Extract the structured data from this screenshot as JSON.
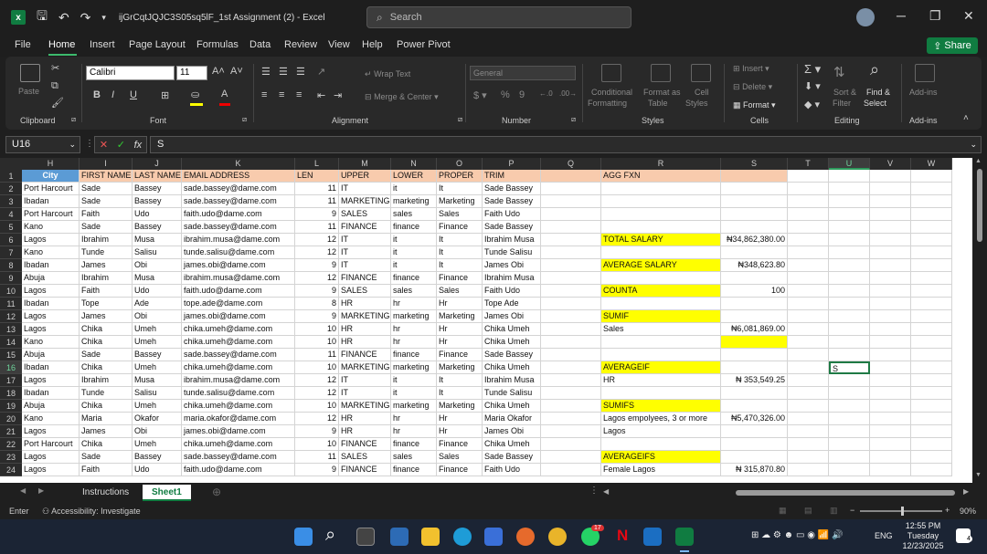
{
  "window": {
    "title": "ijGrCqtJQJC3S05sq5lF_1st Assignment (2)  -  Excel",
    "search_placeholder": "Search"
  },
  "menu": {
    "items": [
      "File",
      "Home",
      "Insert",
      "Page Layout",
      "Formulas",
      "Data",
      "Review",
      "View",
      "Help",
      "Power Pivot"
    ],
    "share_label": "Share"
  },
  "ribbon": {
    "groups": [
      "Clipboard",
      "Font",
      "Alignment",
      "Number",
      "Styles",
      "Cells",
      "Editing",
      "Add-ins"
    ],
    "paste": "Paste",
    "font_name": "Calibri",
    "font_size": "11",
    "wrap_text": "Wrap Text",
    "merge_center": "Merge & Center",
    "number_format": "General",
    "conditional_formatting": [
      "Conditional",
      "Formatting"
    ],
    "format_as_table": [
      "Format as",
      "Table"
    ],
    "cell_styles": [
      "Cell",
      "Styles"
    ],
    "insert": "Insert",
    "delete": "Delete",
    "format": "Format",
    "sort_filter": [
      "Sort &",
      "Filter"
    ],
    "find_select": [
      "Find &",
      "Select"
    ],
    "add_ins": "Add-ins"
  },
  "formula_bar": {
    "name_box": "U16",
    "formula": "S"
  },
  "grid": {
    "columns": [
      "H",
      "I",
      "J",
      "K",
      "L",
      "M",
      "N",
      "O",
      "P",
      "Q",
      "R",
      "S",
      "T",
      "U",
      "V",
      "W"
    ],
    "row_numbers": [
      "1",
      "2",
      "3",
      "4",
      "5",
      "6",
      "7",
      "8",
      "9",
      "10",
      "11",
      "12",
      "13",
      "14",
      "15",
      "16",
      "17",
      "18",
      "19",
      "20",
      "21",
      "22",
      "23",
      "24"
    ],
    "headers": [
      "City",
      "FIRST NAME",
      "LAST NAME",
      "EMAIL ADDRESS",
      "LEN",
      "UPPER",
      "LOWER",
      "PROPER",
      "TRIM",
      "AGG FXN"
    ],
    "rows": [
      [
        "Port Harcourt",
        "Sade",
        "Bassey",
        "sade.bassey@dame.com",
        "11",
        "IT",
        "it",
        "It",
        "Sade Bassey"
      ],
      [
        "Ibadan",
        "Sade",
        "Bassey",
        "sade.bassey@dame.com",
        "11",
        "MARKETING",
        "marketing",
        "Marketing",
        "Sade Bassey"
      ],
      [
        "Port Harcourt",
        "Faith",
        "Udo",
        "faith.udo@dame.com",
        "9",
        "SALES",
        "sales",
        "Sales",
        "Faith Udo"
      ],
      [
        "Kano",
        "Sade",
        "Bassey",
        "sade.bassey@dame.com",
        "11",
        "FINANCE",
        "finance",
        "Finance",
        "Sade Bassey"
      ],
      [
        "Lagos",
        "Ibrahim",
        "Musa",
        "ibrahim.musa@dame.com",
        "12",
        "IT",
        "it",
        "It",
        "Ibrahim Musa"
      ],
      [
        "Kano",
        "Tunde",
        "Salisu",
        "tunde.salisu@dame.com",
        "12",
        "IT",
        "it",
        "It",
        "Tunde Salisu"
      ],
      [
        "Ibadan",
        "James",
        "Obi",
        "james.obi@dame.com",
        "9",
        "IT",
        "it",
        "It",
        "James Obi"
      ],
      [
        "Abuja",
        "Ibrahim",
        "Musa",
        "ibrahim.musa@dame.com",
        "12",
        "FINANCE",
        "finance",
        "Finance",
        "Ibrahim Musa"
      ],
      [
        "Lagos",
        "Faith",
        "Udo",
        "faith.udo@dame.com",
        "9",
        "SALES",
        "sales",
        "Sales",
        "Faith Udo"
      ],
      [
        "Ibadan",
        "Tope",
        "Ade",
        "tope.ade@dame.com",
        "8",
        "HR",
        "hr",
        "Hr",
        "Tope Ade"
      ],
      [
        "Lagos",
        "James",
        "Obi",
        "james.obi@dame.com",
        "9",
        "MARKETING",
        "marketing",
        "Marketing",
        "James Obi"
      ],
      [
        "Lagos",
        "Chika",
        "Umeh",
        "chika.umeh@dame.com",
        "10",
        "HR",
        "hr",
        "Hr",
        "Chika Umeh"
      ],
      [
        "Kano",
        "Chika",
        "Umeh",
        "chika.umeh@dame.com",
        "10",
        "HR",
        "hr",
        "Hr",
        "Chika Umeh"
      ],
      [
        "Abuja",
        "Sade",
        "Bassey",
        "sade.bassey@dame.com",
        "11",
        "FINANCE",
        "finance",
        "Finance",
        "Sade Bassey"
      ],
      [
        "Ibadan",
        "Chika",
        "Umeh",
        "chika.umeh@dame.com",
        "10",
        "MARKETING",
        "marketing",
        "Marketing",
        "Chika Umeh"
      ],
      [
        "Lagos",
        "Ibrahim",
        "Musa",
        "ibrahim.musa@dame.com",
        "12",
        "IT",
        "it",
        "It",
        "Ibrahim Musa"
      ],
      [
        "Ibadan",
        "Tunde",
        "Salisu",
        "tunde.salisu@dame.com",
        "12",
        "IT",
        "it",
        "It",
        "Tunde Salisu"
      ],
      [
        "Abuja",
        "Chika",
        "Umeh",
        "chika.umeh@dame.com",
        "10",
        "MARKETING",
        "marketing",
        "Marketing",
        "Chika Umeh"
      ],
      [
        "Kano",
        "Maria",
        "Okafor",
        "maria.okafor@dame.com",
        "12",
        "HR",
        "hr",
        "Hr",
        "Maria Okafor"
      ],
      [
        "Lagos",
        "James",
        "Obi",
        "james.obi@dame.com",
        "9",
        "HR",
        "hr",
        "Hr",
        "James Obi"
      ],
      [
        "Port Harcourt",
        "Chika",
        "Umeh",
        "chika.umeh@dame.com",
        "10",
        "FINANCE",
        "finance",
        "Finance",
        "Chika Umeh"
      ],
      [
        "Lagos",
        "Sade",
        "Bassey",
        "sade.bassey@dame.com",
        "11",
        "SALES",
        "sales",
        "Sales",
        "Sade Bassey"
      ],
      [
        "Lagos",
        "Faith",
        "Udo",
        "faith.udo@dame.com",
        "9",
        "FINANCE",
        "finance",
        "Finance",
        "Faith Udo"
      ]
    ],
    "agg": [
      {
        "row": 6,
        "r": "TOTAL SALARY",
        "r_yellow": true,
        "s": "₦34,862,380.00",
        "s_yellow": false
      },
      {
        "row": 8,
        "r": "AVERAGE SALARY",
        "r_yellow": true,
        "s": "₦348,623.80",
        "s_yellow": false
      },
      {
        "row": 10,
        "r": "COUNTA",
        "r_yellow": true,
        "s": "100",
        "s_yellow": false
      },
      {
        "row": 12,
        "r": "SUMIF",
        "r_yellow": true,
        "s": "",
        "s_yellow": false
      },
      {
        "row": 13,
        "r": "Sales",
        "r_yellow": false,
        "s": "₦6,081,869.00",
        "s_yellow": false
      },
      {
        "row": 14,
        "r": "",
        "r_yellow": false,
        "s": "",
        "s_yellow": true
      },
      {
        "row": 16,
        "r": "AVERAGEIF",
        "r_yellow": true,
        "s": "",
        "s_yellow": false
      },
      {
        "row": 17,
        "r": "HR",
        "r_yellow": false,
        "s": "₦  353,549.25",
        "s_yellow": false
      },
      {
        "row": 19,
        "r": "SUMIFS",
        "r_yellow": true,
        "s": "",
        "s_yellow": false
      },
      {
        "row": 20,
        "r": "Lagos empolyees, 3 or more",
        "r_yellow": false,
        "s": "₦5,470,326.00",
        "s_yellow": false
      },
      {
        "row": 21,
        "r": "Lagos",
        "r_yellow": false,
        "s": "",
        "s_yellow": false
      },
      {
        "row": 23,
        "r": "AVERAGEIFS",
        "r_yellow": true,
        "s": "",
        "s_yellow": false
      },
      {
        "row": 24,
        "r": "Female Lagos",
        "r_yellow": false,
        "s": "₦  315,870.80",
        "s_yellow": false
      }
    ],
    "active_cell_value": "S"
  },
  "sheets": {
    "tabs": [
      "Instructions",
      "Sheet1"
    ],
    "active": "Sheet1"
  },
  "status": {
    "mode": "Enter",
    "accessibility": "Accessibility: Investigate",
    "zoom": "90%"
  },
  "taskbar": {
    "time": "12:55 PM",
    "day": "Tuesday",
    "date": "12/23/2025",
    "lang": "ENG",
    "notif_badge": "17",
    "corner_badge": "4"
  }
}
